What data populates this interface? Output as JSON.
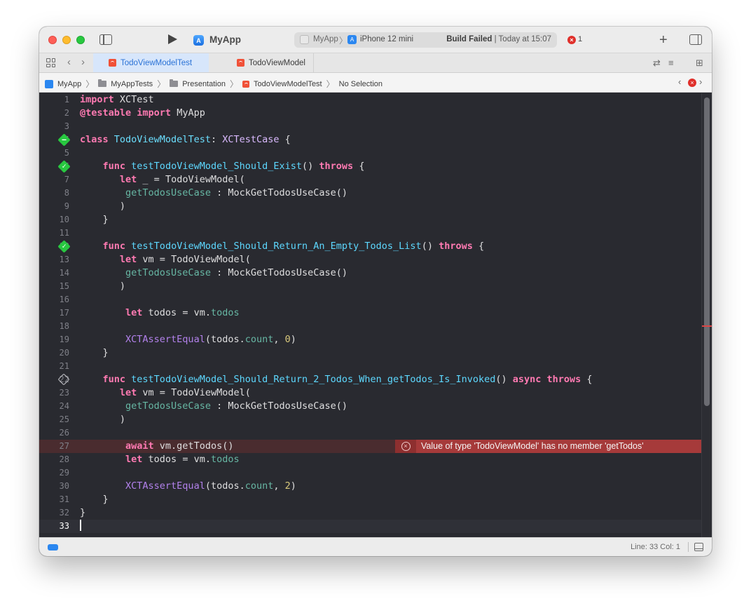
{
  "toolbar": {
    "app_name": "MyApp",
    "scheme": "MyApp",
    "destination": "iPhone 12 mini",
    "build_status_bold": "Build Failed",
    "build_status_rest": " | Today at 15:07",
    "error_count": "1"
  },
  "tabs": [
    {
      "label": "TodoViewModelTest",
      "active": true
    },
    {
      "label": "TodoViewModel",
      "active": false
    }
  ],
  "breadcrumb": [
    "MyApp",
    "MyAppTests",
    "Presentation",
    "TodoViewModelTest",
    "No Selection"
  ],
  "editor": {
    "lines": [
      {
        "n": "1",
        "tokens": [
          [
            "kw",
            "import"
          ],
          [
            "plain",
            " XCTest"
          ]
        ]
      },
      {
        "n": "2",
        "tokens": [
          [
            "kw",
            "@testable"
          ],
          [
            "plain",
            " "
          ],
          [
            "kw",
            "import"
          ],
          [
            "plain",
            " MyApp"
          ]
        ]
      },
      {
        "n": "3",
        "tokens": []
      },
      {
        "n": "4",
        "gutter": "pass-minus",
        "tokens": [
          [
            "kw",
            "class"
          ],
          [
            "plain",
            " "
          ],
          [
            "fn",
            "TodoViewModelTest"
          ],
          [
            "plain",
            ": "
          ],
          [
            "tp",
            "XCTestCase"
          ],
          [
            "plain",
            " {"
          ]
        ]
      },
      {
        "n": "5",
        "tokens": []
      },
      {
        "n": "6",
        "gutter": "pass",
        "tokens": [
          [
            "plain",
            "    "
          ],
          [
            "kw",
            "func"
          ],
          [
            "plain",
            " "
          ],
          [
            "cl",
            "testTodoViewModel_Should_Exist"
          ],
          [
            "plain",
            "() "
          ],
          [
            "kw",
            "throws"
          ],
          [
            "plain",
            " {"
          ]
        ]
      },
      {
        "n": "7",
        "tokens": [
          [
            "plain",
            "       "
          ],
          [
            "kw",
            "let"
          ],
          [
            "plain",
            " _ = "
          ],
          [
            "plain",
            "TodoViewModel("
          ]
        ]
      },
      {
        "n": "8",
        "tokens": [
          [
            "plain",
            "        "
          ],
          [
            "pr",
            "getTodosUseCase"
          ],
          [
            "plain",
            " : "
          ],
          [
            "plain",
            "MockGetTodosUseCase()"
          ]
        ]
      },
      {
        "n": "9",
        "tokens": [
          [
            "plain",
            "       )"
          ]
        ]
      },
      {
        "n": "10",
        "tokens": [
          [
            "plain",
            "    }"
          ]
        ]
      },
      {
        "n": "11",
        "tokens": []
      },
      {
        "n": "12",
        "gutter": "pass",
        "tokens": [
          [
            "plain",
            "    "
          ],
          [
            "kw",
            "func"
          ],
          [
            "plain",
            " "
          ],
          [
            "cl",
            "testTodoViewModel_Should_Return_An_Empty_Todos_List"
          ],
          [
            "plain",
            "() "
          ],
          [
            "kw",
            "throws"
          ],
          [
            "plain",
            " {"
          ]
        ]
      },
      {
        "n": "13",
        "tokens": [
          [
            "plain",
            "       "
          ],
          [
            "kw",
            "let"
          ],
          [
            "plain",
            " vm = "
          ],
          [
            "plain",
            "TodoViewModel("
          ]
        ]
      },
      {
        "n": "14",
        "tokens": [
          [
            "plain",
            "        "
          ],
          [
            "pr",
            "getTodosUseCase"
          ],
          [
            "plain",
            " : "
          ],
          [
            "plain",
            "MockGetTodosUseCase()"
          ]
        ]
      },
      {
        "n": "15",
        "tokens": [
          [
            "plain",
            "       )"
          ]
        ]
      },
      {
        "n": "16",
        "tokens": []
      },
      {
        "n": "17",
        "tokens": [
          [
            "plain",
            "        "
          ],
          [
            "kw",
            "let"
          ],
          [
            "plain",
            " todos = vm."
          ],
          [
            "pr",
            "todos"
          ]
        ]
      },
      {
        "n": "18",
        "tokens": []
      },
      {
        "n": "19",
        "tokens": [
          [
            "plain",
            "        "
          ],
          [
            "mt",
            "XCTAssertEqual"
          ],
          [
            "plain",
            "(todos."
          ],
          [
            "pr",
            "count"
          ],
          [
            "plain",
            ", "
          ],
          [
            "num",
            "0"
          ],
          [
            "plain",
            ")"
          ]
        ]
      },
      {
        "n": "20",
        "tokens": [
          [
            "plain",
            "    }"
          ]
        ]
      },
      {
        "n": "21",
        "tokens": []
      },
      {
        "n": "22",
        "gutter": "empty",
        "tokens": [
          [
            "plain",
            "    "
          ],
          [
            "kw",
            "func"
          ],
          [
            "plain",
            " "
          ],
          [
            "cl",
            "testTodoViewModel_Should_Return_2_Todos_When_getTodos_Is_Invoked"
          ],
          [
            "plain",
            "() "
          ],
          [
            "kw",
            "async"
          ],
          [
            "plain",
            " "
          ],
          [
            "kw",
            "throws"
          ],
          [
            "plain",
            " {"
          ]
        ]
      },
      {
        "n": "23",
        "tokens": [
          [
            "plain",
            "       "
          ],
          [
            "kw",
            "let"
          ],
          [
            "plain",
            " vm = "
          ],
          [
            "plain",
            "TodoViewModel("
          ]
        ]
      },
      {
        "n": "24",
        "tokens": [
          [
            "plain",
            "        "
          ],
          [
            "pr",
            "getTodosUseCase"
          ],
          [
            "plain",
            " : "
          ],
          [
            "plain",
            "MockGetTodosUseCase()"
          ]
        ]
      },
      {
        "n": "25",
        "tokens": [
          [
            "plain",
            "       )"
          ]
        ]
      },
      {
        "n": "26",
        "tokens": []
      },
      {
        "n": "27",
        "error": true,
        "tokens": [
          [
            "plain",
            "        "
          ],
          [
            "kw",
            "await"
          ],
          [
            "plain",
            " vm.getTodos()"
          ]
        ]
      },
      {
        "n": "28",
        "tokens": [
          [
            "plain",
            "        "
          ],
          [
            "kw",
            "let"
          ],
          [
            "plain",
            " todos = vm."
          ],
          [
            "pr",
            "todos"
          ]
        ]
      },
      {
        "n": "29",
        "tokens": []
      },
      {
        "n": "30",
        "tokens": [
          [
            "plain",
            "        "
          ],
          [
            "mt",
            "XCTAssertEqual"
          ],
          [
            "plain",
            "(todos."
          ],
          [
            "pr",
            "count"
          ],
          [
            "plain",
            ", "
          ],
          [
            "num",
            "2"
          ],
          [
            "plain",
            ")"
          ]
        ]
      },
      {
        "n": "31",
        "tokens": [
          [
            "plain",
            "    }"
          ]
        ]
      },
      {
        "n": "32",
        "tokens": [
          [
            "plain",
            "}"
          ]
        ]
      },
      {
        "n": "33",
        "current": true,
        "tokens": []
      }
    ],
    "error_message": "Value of type 'TodoViewModel' has no member 'getTodos'"
  },
  "status": {
    "cursor_position": "Line: 33  Col: 1"
  },
  "colors": {
    "editor_bg": "#292a30",
    "keyword": "#ff7ab2",
    "error_line": "#4a2c2f",
    "error_annotation": "#a63a3a",
    "test_pass": "#28c840",
    "accent": "#2a72d6"
  }
}
